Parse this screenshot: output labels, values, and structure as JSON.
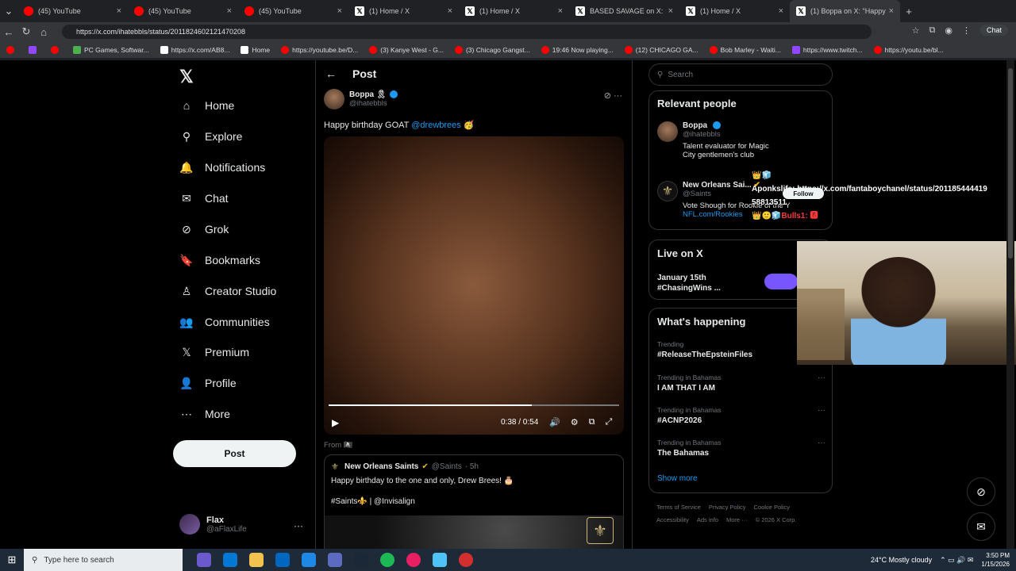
{
  "browser": {
    "tabs": [
      {
        "title": "(45) YouTube",
        "icon": "youtube-icon",
        "kind": "yt"
      },
      {
        "title": "(45) YouTube",
        "icon": "youtube-icon",
        "kind": "yt"
      },
      {
        "title": "(45) YouTube",
        "icon": "youtube-icon",
        "kind": "yt"
      },
      {
        "title": "(1) Home / X",
        "icon": "x-icon",
        "kind": "x"
      },
      {
        "title": "(1) Home / X",
        "icon": "x-icon",
        "kind": "x"
      },
      {
        "title": "BASED SAVAGE on X: \"Th",
        "icon": "x-icon",
        "kind": "x"
      },
      {
        "title": "(1) Home / X",
        "icon": "x-icon",
        "kind": "x"
      },
      {
        "title": "(1) Boppa on X: \"Happy",
        "icon": "x-icon",
        "kind": "x",
        "active": true
      }
    ],
    "url": "https://x.com/ihatebbls/status/2011824602121470208",
    "chat_label": "Chat",
    "bookmarks": [
      {
        "label": "",
        "kind": "yt"
      },
      {
        "label": "",
        "kind": "tw"
      },
      {
        "label": "",
        "kind": "yt"
      },
      {
        "label": "PC Games, Softwar...",
        "kind": "g"
      },
      {
        "label": "https://x.com/AB8...",
        "kind": "x"
      },
      {
        "label": "Home",
        "kind": "x"
      },
      {
        "label": "https://youtube.be/D...",
        "kind": "yt"
      },
      {
        "label": "(3) Kanye West - G...",
        "kind": "yt"
      },
      {
        "label": "(3) Chicago Gangst...",
        "kind": "yt"
      },
      {
        "label": "19:46 Now playing...",
        "kind": "yt"
      },
      {
        "label": "(12) CHICAGO GA...",
        "kind": "yt"
      },
      {
        "label": "Bob Marley - Waiti...",
        "kind": "yt"
      },
      {
        "label": "https://www.twitch...",
        "kind": "tw"
      },
      {
        "label": "https://youtu.be/bl...",
        "kind": "yt"
      }
    ]
  },
  "nav": {
    "items": [
      {
        "label": "Home",
        "icon": "home-icon",
        "glyph": "⌂"
      },
      {
        "label": "Explore",
        "icon": "search-icon",
        "glyph": "⚲"
      },
      {
        "label": "Notifications",
        "icon": "bell-icon",
        "glyph": "🔔"
      },
      {
        "label": "Chat",
        "icon": "chat-icon",
        "glyph": "✉"
      },
      {
        "label": "Grok",
        "icon": "grok-icon",
        "glyph": "⊘"
      },
      {
        "label": "Bookmarks",
        "icon": "bookmark-icon",
        "glyph": "🔖"
      },
      {
        "label": "Creator Studio",
        "icon": "creator-icon",
        "glyph": "♙"
      },
      {
        "label": "Communities",
        "icon": "communities-icon",
        "glyph": "👥"
      },
      {
        "label": "Premium",
        "icon": "x-icon",
        "glyph": "𝕏"
      },
      {
        "label": "Profile",
        "icon": "profile-icon",
        "glyph": "👤"
      },
      {
        "label": "More",
        "icon": "more-icon",
        "glyph": "⋯"
      }
    ],
    "post_button": "Post",
    "account": {
      "name": "Flax",
      "handle": "@aFlaxLife"
    }
  },
  "main": {
    "title": "Post",
    "author": {
      "name": "Boppa",
      "handle": "@ihatebbls"
    },
    "text_prefix": "Happy birthday GOAT ",
    "mention": "@drewbrees",
    "emoji": "🥳",
    "video": {
      "time": "0:38 / 0:54",
      "progress": 0.7
    },
    "from_label": "From 🏴‍☠️",
    "quote": {
      "name": "New Orleans Saints",
      "handle": "@Saints",
      "age": "· 5h",
      "text": "Happy birthday to the one and only, Drew Brees! 🎂",
      "tags": "#Saints⚜️ | @Invisalign"
    }
  },
  "right": {
    "search_placeholder": "Search",
    "relevant_title": "Relevant people",
    "people": [
      {
        "name": "Boppa",
        "handle": "@ihatebbls",
        "bio": "Talent evaluator for Magic City gentlemen's club",
        "link": ""
      },
      {
        "name": "New Orleans Sai...",
        "handle": "@Saints",
        "bio": "Vote Shough for Rookie of the Y",
        "link": "NFL.com/Rookies"
      }
    ],
    "live_title": "Live on X",
    "live": {
      "date": "January 15th",
      "tag": "#ChasingWins ..."
    },
    "happening_title": "What's happening",
    "trends": [
      {
        "context": "Trending",
        "title": "#ReleaseTheEpsteinFiles"
      },
      {
        "context": "Trending in Bahamas",
        "title": "I AM THAT I AM"
      },
      {
        "context": "Trending in Bahamas",
        "title": "#ACNP2026"
      },
      {
        "context": "Trending in Bahamas",
        "title": "The Bahamas"
      }
    ],
    "show_more": "Show more",
    "footer": [
      "Terms of Service",
      "Privacy Policy",
      "Cookie Policy",
      "Accessibility",
      "Ads info",
      "More ···",
      "© 2026 X Corp."
    ]
  },
  "overlay": {
    "line1": "👑🧊",
    "line2": "Aponkslife: https://x.com/fantaboychanel/status/201185444419",
    "line3": "58813511",
    "line4_prefix": "👑🙂🧊",
    "line4_red": "Bulls1: 🅱",
    "follow": "Follow"
  },
  "taskbar": {
    "search": "Type here to search",
    "weather": "24°C  Mostly cloudy",
    "time": "3:50 PM",
    "date": "1/15/2026"
  }
}
